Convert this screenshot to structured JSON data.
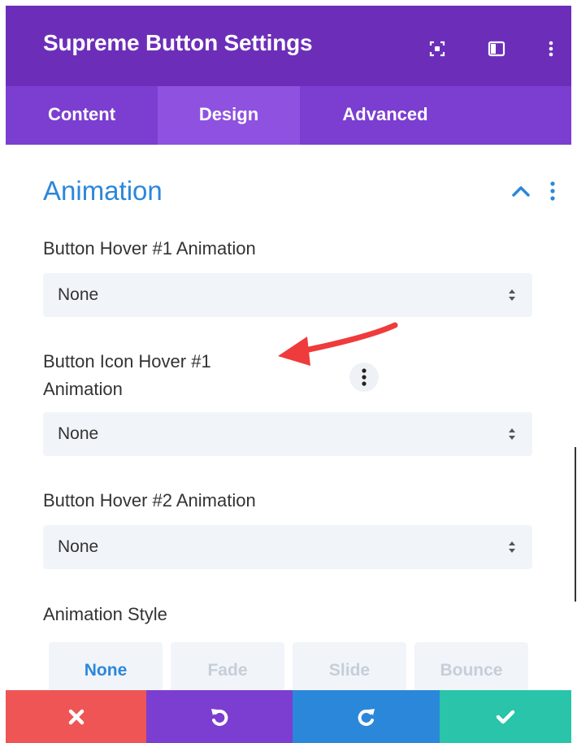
{
  "header": {
    "title": "Supreme Button Settings",
    "icons": [
      "focus-icon",
      "split-layout-icon",
      "more-vertical-icon"
    ]
  },
  "tabs": [
    {
      "label": "Content",
      "active": false
    },
    {
      "label": "Design",
      "active": true
    },
    {
      "label": "Advanced",
      "active": false
    }
  ],
  "section": {
    "title": "Animation",
    "accent_color": "#2b87da"
  },
  "fields": [
    {
      "label": "Button Hover #1 Animation",
      "value": "None"
    },
    {
      "label_line1": "Button Icon Hover #1",
      "label_line2": "Animation",
      "value": "None"
    },
    {
      "label": "Button Hover #2 Animation",
      "value": "None"
    }
  ],
  "animation_style": {
    "label": "Animation Style",
    "options": [
      "None",
      "Fade",
      "Slide",
      "Bounce"
    ],
    "selected": "None"
  },
  "footer": {
    "buttons": [
      {
        "name": "discard",
        "icon": "close-icon",
        "color": "#ef5555"
      },
      {
        "name": "undo",
        "icon": "undo-icon",
        "color": "#7b3ed0"
      },
      {
        "name": "redo",
        "icon": "redo-icon",
        "color": "#2b87da"
      },
      {
        "name": "save",
        "icon": "check-icon",
        "color": "#29c4a9"
      }
    ]
  },
  "colors": {
    "header_bg": "#6c2eb9",
    "tabs_bg": "#7b3ed0",
    "active_tab_bg": "#8f51e0",
    "annotation_arrow": "#ef3b3b"
  }
}
